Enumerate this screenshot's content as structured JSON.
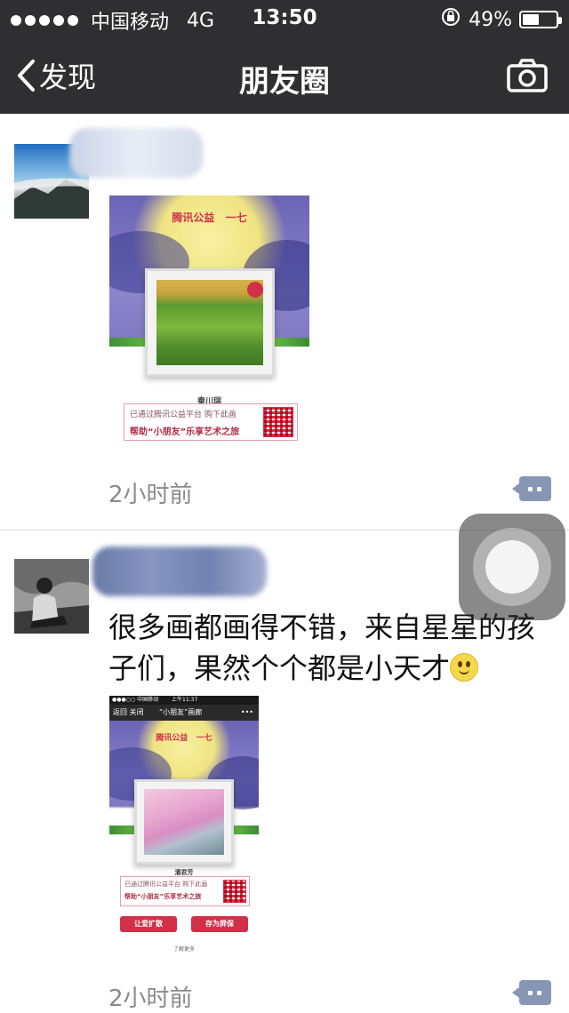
{
  "status_bar": {
    "carrier": "中国移动",
    "network": "4G",
    "time": "13:50",
    "battery": "49%",
    "battery_level": 0.49
  },
  "nav": {
    "back_label": "发现",
    "title": "朋友圈",
    "camera_icon": "camera-icon"
  },
  "posts": [
    {
      "text": "",
      "image": {
        "logo_left": "腾讯公益",
        "logo_right": "一七",
        "artist": "秦川瑞",
        "line1": "已通过腾讯公益平台  购下此画",
        "line2": "帮助“小朋友”乐享艺术之旅"
      },
      "time": "2小时前"
    },
    {
      "text": "很多画都画得不错，来自星星的孩子们，果然个个都是小天才",
      "image": {
        "phone_status": "●●●○○ 中国移动",
        "phone_time": "上午11:37",
        "phone_nav_back": "返回  关闭",
        "phone_nav_title": "“小朋友”画廊",
        "logo_left": "腾讯公益",
        "logo_right": "一七",
        "artist": "潘君芳",
        "line1": "已通过腾讯公益平台  购下此画",
        "line2": "帮助“小朋友”乐享艺术之旅",
        "button_left": "让爱扩散",
        "button_right": "存为屏保",
        "more": "了解更多"
      },
      "time": "2小时前"
    }
  ],
  "colors": {
    "header_bg": "#2f2f31",
    "comment_btn": "#8796b4",
    "time_text": "#8a8a8a",
    "accent_red": "#d23048"
  }
}
